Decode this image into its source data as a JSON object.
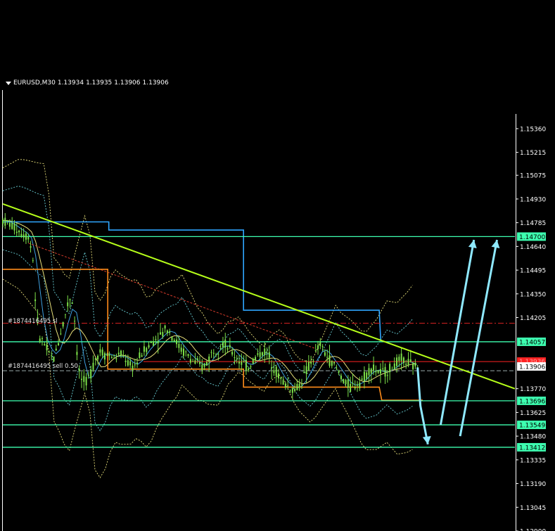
{
  "header": {
    "symbol": "EURUSD,M30",
    "open": "1.13934",
    "high": "1.13935",
    "low": "1.13906",
    "close": "1.13906"
  },
  "orders": {
    "sl_label": "#1874416495 sl",
    "sell_label": "#1874416495 sell 0.50"
  },
  "chart_data": {
    "type": "line",
    "title": "",
    "symbol": "EURUSD",
    "timeframe": "M30",
    "ylim": [
      1.129,
      1.1545
    ],
    "y_ticks": [
      "1.15360",
      "1.15215",
      "1.15075",
      "1.14930",
      "1.14785",
      "1.14640",
      "1.14495",
      "1.14350",
      "1.14205",
      "1.13770",
      "1.13625",
      "1.13480",
      "1.13335",
      "1.13190",
      "1.13045",
      "1.12900"
    ],
    "grid": false,
    "horizontal_levels": [
      {
        "label": "1.14700",
        "value": 1.147
      },
      {
        "label": "1.14057",
        "value": 1.14057
      },
      {
        "label": "1.13696",
        "value": 1.13696
      },
      {
        "label": "1.13549",
        "value": 1.13549
      },
      {
        "label": "1.13412",
        "value": 1.13412
      }
    ],
    "current_price": {
      "label": "1.13906",
      "value": 1.13906
    },
    "sl_price": {
      "label": "1.13936",
      "value": 1.13936
    },
    "sl_level": 1.1417,
    "sell_level": 1.1388,
    "trendline": [
      [
        0,
        1.149
      ],
      [
        1,
        1.1377
      ]
    ],
    "price_path": [
      [
        0.0,
        1.148
      ],
      [
        0.012,
        1.1478
      ],
      [
        0.025,
        1.1475
      ],
      [
        0.038,
        1.1472
      ],
      [
        0.05,
        1.147
      ],
      [
        0.058,
        1.146
      ],
      [
        0.064,
        1.143
      ],
      [
        0.07,
        1.141
      ],
      [
        0.08,
        1.1405
      ],
      [
        0.09,
        1.1398
      ],
      [
        0.1,
        1.1395
      ],
      [
        0.11,
        1.1408
      ],
      [
        0.12,
        1.142
      ],
      [
        0.128,
        1.143
      ],
      [
        0.134,
        1.1435
      ],
      [
        0.14,
        1.142
      ],
      [
        0.146,
        1.1395
      ],
      [
        0.15,
        1.1385
      ],
      [
        0.16,
        1.138
      ],
      [
        0.17,
        1.1385
      ],
      [
        0.18,
        1.1395
      ],
      [
        0.19,
        1.14
      ],
      [
        0.2,
        1.1398
      ],
      [
        0.21,
        1.1397
      ],
      [
        0.22,
        1.1396
      ],
      [
        0.23,
        1.1398
      ],
      [
        0.24,
        1.1395
      ],
      [
        0.25,
        1.139
      ],
      [
        0.26,
        1.1392
      ],
      [
        0.27,
        1.1398
      ],
      [
        0.28,
        1.1402
      ],
      [
        0.29,
        1.1405
      ],
      [
        0.3,
        1.1408
      ],
      [
        0.31,
        1.141
      ],
      [
        0.32,
        1.1415
      ],
      [
        0.33,
        1.141
      ],
      [
        0.34,
        1.1405
      ],
      [
        0.35,
        1.14
      ],
      [
        0.36,
        1.1398
      ],
      [
        0.37,
        1.1394
      ],
      [
        0.38,
        1.1392
      ],
      [
        0.39,
        1.139
      ],
      [
        0.4,
        1.1394
      ],
      [
        0.41,
        1.14
      ],
      [
        0.42,
        1.1402
      ],
      [
        0.43,
        1.1405
      ],
      [
        0.44,
        1.1402
      ],
      [
        0.45,
        1.1398
      ],
      [
        0.46,
        1.1395
      ],
      [
        0.47,
        1.1392
      ],
      [
        0.48,
        1.139
      ],
      [
        0.49,
        1.1395
      ],
      [
        0.5,
        1.1398
      ],
      [
        0.51,
        1.14
      ],
      [
        0.52,
        1.1397
      ],
      [
        0.53,
        1.139
      ],
      [
        0.54,
        1.1384
      ],
      [
        0.55,
        1.138
      ],
      [
        0.56,
        1.1378
      ],
      [
        0.57,
        1.1376
      ],
      [
        0.58,
        1.138
      ],
      [
        0.59,
        1.1386
      ],
      [
        0.6,
        1.1392
      ],
      [
        0.61,
        1.1398
      ],
      [
        0.62,
        1.1404
      ],
      [
        0.63,
        1.1398
      ],
      [
        0.64,
        1.1394
      ],
      [
        0.65,
        1.139
      ],
      [
        0.66,
        1.1385
      ],
      [
        0.67,
        1.138
      ],
      [
        0.68,
        1.1378
      ],
      [
        0.69,
        1.138
      ],
      [
        0.7,
        1.1382
      ],
      [
        0.71,
        1.1386
      ],
      [
        0.72,
        1.139
      ],
      [
        0.73,
        1.1388
      ],
      [
        0.74,
        1.1386
      ],
      [
        0.75,
        1.1388
      ],
      [
        0.76,
        1.139
      ],
      [
        0.77,
        1.1393
      ],
      [
        0.78,
        1.1395
      ],
      [
        0.79,
        1.1393
      ],
      [
        0.8,
        1.1391
      ],
      [
        0.81,
        1.139
      ]
    ],
    "projections": [
      {
        "type": "down",
        "from": [
          0.81,
          1.139
        ],
        "to": [
          0.83,
          1.1343
        ]
      },
      {
        "type": "up",
        "from": [
          0.855,
          1.1355
        ],
        "to": [
          0.92,
          1.1468
        ]
      },
      {
        "type": "up",
        "from": [
          0.893,
          1.1348
        ],
        "to": [
          0.965,
          1.1468
        ]
      }
    ],
    "colors": {
      "background": "#000000",
      "levels": "#3dffb0",
      "trendline": "#b6ff1a",
      "candles": "#7ee34a",
      "blue_stop": "#2fa6ff",
      "orange_stop": "#ff8c1a",
      "arrows": "#8fe9ff",
      "sl_line": "#ff2222",
      "current_price_box": "#ffffff"
    }
  }
}
